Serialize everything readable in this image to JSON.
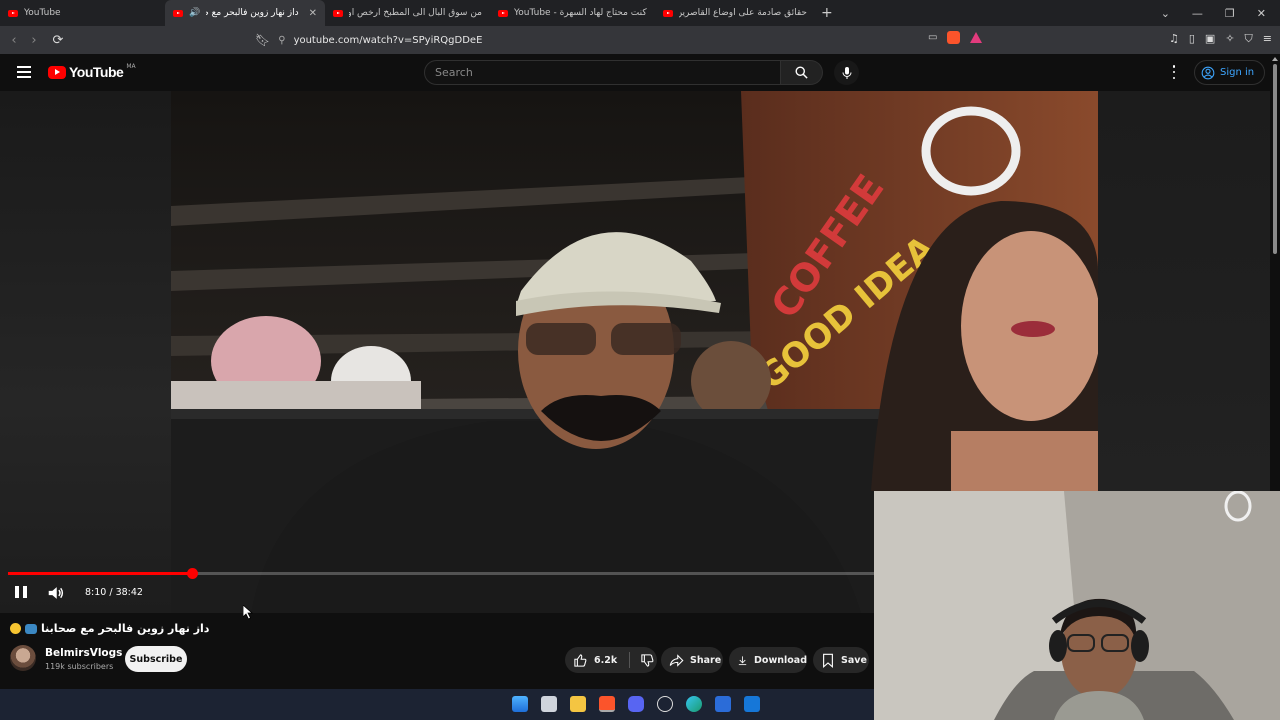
{
  "browser": {
    "tabs": [
      {
        "title": "YouTube",
        "active": false
      },
      {
        "title": "داز نهار زوين فالبحر مع صحابنا",
        "active": true,
        "audio": true
      },
      {
        "title": "من سوق البال الى المطبخ ارخص اوتيف...",
        "active": false
      },
      {
        "title": "YouTube - كنت محتاج لهاد السهرة",
        "active": false
      },
      {
        "title": "حقائق صادمة على أوضاع القاصرين فـ...",
        "active": false
      }
    ],
    "new_tab_label": "+",
    "url": "youtube.com/watch?v=SPyiRQgDDeE"
  },
  "youtube": {
    "logo_text": "YouTube",
    "region": "MA",
    "search_placeholder": "Search",
    "signin_label": "Sign in"
  },
  "player": {
    "progress_fraction": 0.212,
    "time_current": "8:10",
    "time_total": "38:42",
    "time_display": "8:10 / 38:42",
    "playing": true
  },
  "video": {
    "title": "داز نهار زوين فالبحر مع صحابنا",
    "channel": "BelmirsVlogs",
    "subscribers": "119k subscribers",
    "subscribe_label": "Subscribe",
    "likes": "6.2k",
    "share_label": "Share",
    "download_label": "Download",
    "save_label": "Save"
  },
  "colors": {
    "accent": "#ff0000",
    "link": "#3ea6ff",
    "background": "#0f0f0f"
  }
}
